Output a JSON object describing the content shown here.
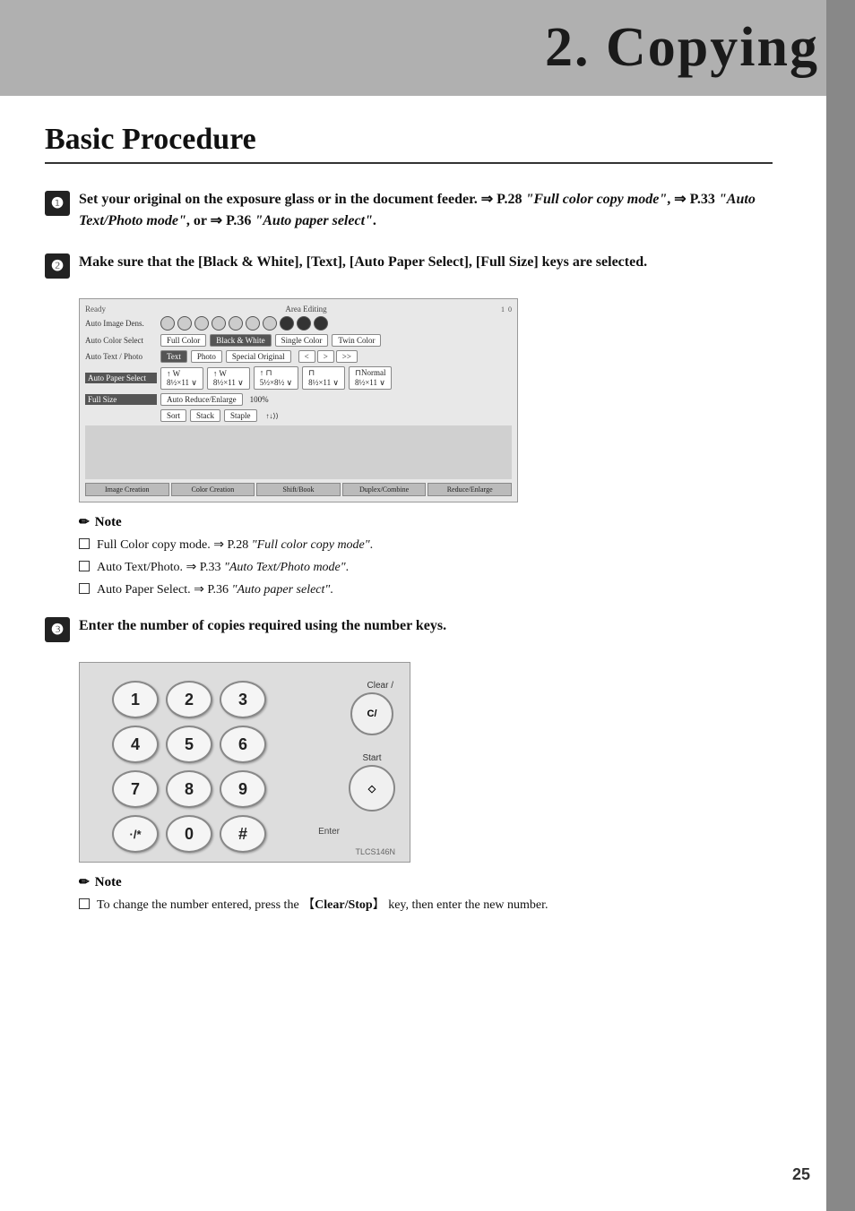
{
  "header": {
    "title": "2. Copying",
    "background": "#b0b0b0"
  },
  "section": {
    "title": "Basic Procedure"
  },
  "steps": [
    {
      "number": "1",
      "icon_char": "❶",
      "content": "Set your original on the exposure glass or in the document feeder. ⇒ P.28 \"Full color copy mode\", ⇒ P.33 \"Auto Text/Photo mode\", or ⇒ P.36 \"Auto paper select\"."
    },
    {
      "number": "2",
      "icon_char": "❷",
      "content": "Make sure that the [Black & White], [Text], [Auto Paper Select], [Full Size] keys are selected."
    },
    {
      "number": "3",
      "icon_char": "❸",
      "content": "Enter the number of copies required using the number keys."
    }
  ],
  "control_panel": {
    "ready_label": "Ready",
    "area_editing_label": "Area Editing",
    "auto_image_density_label": "Auto Image Dens.",
    "auto_color_select_label": "Auto Color Select",
    "color_options": [
      "Full Color",
      "Black & White",
      "Single Color",
      "Twin Color"
    ],
    "auto_text_photo_label": "Auto Text / Photo",
    "text_photo_options": [
      "Text",
      "Photo",
      "Special Original"
    ],
    "paper_sizes": [
      "8½×11",
      "8½×11",
      "5½×8½",
      "8½×11",
      "8½×11"
    ],
    "auto_paper_select_label": "Auto Paper Select",
    "full_size_label": "Full Size",
    "reduce_enlarge_label": "Auto Reduce/Enlarge",
    "percentage": "100%",
    "bottom_options": [
      "Sort",
      "Stack",
      "Staple"
    ],
    "footer_tabs": [
      "Image Creation",
      "Color Creation",
      "Shift/Book",
      "Duplex/Combine",
      "Reduce/Enlarge"
    ]
  },
  "notes": [
    {
      "section": "note1",
      "title": "Note",
      "items": [
        "Full Color copy mode. ⇒ P.28 \"Full color copy mode\".",
        "Auto Text/Photo. ⇒ P.33 \"Auto Text/Photo mode\".",
        "Auto Paper Select. ⇒ P.36 \"Auto paper select\"."
      ]
    },
    {
      "section": "note2",
      "title": "Note",
      "items": [
        "To change the number entered, press the 【Clear/Stop】 key, then enter the new number."
      ]
    }
  ],
  "keypad": {
    "keys": [
      "1",
      "2",
      "3",
      "4",
      "5",
      "6",
      "7",
      "8",
      "9",
      "·/*",
      "0",
      "#"
    ],
    "clear_label": "Clear /\nC/",
    "start_label": "Start",
    "enter_label": "Enter",
    "model": "TLCS146N"
  },
  "page_number": "25"
}
